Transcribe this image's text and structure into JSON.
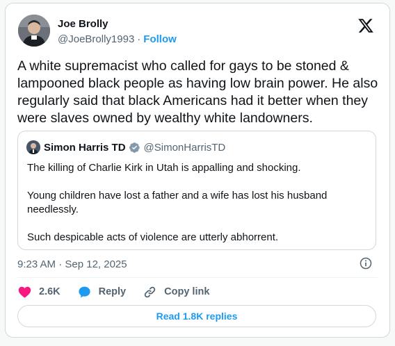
{
  "author": {
    "name": "Joe Brolly",
    "handle": "@JoeBrolly1993",
    "separator": "·",
    "follow_label": "Follow"
  },
  "tweet": {
    "text": "A white supremacist who called for gays to be stoned & lampooned black people as having low brain power. He also regularly said that black Americans had it better when they were slaves owned by wealthy white landowners."
  },
  "quoted": {
    "name": "Simon Harris TD",
    "handle": "@SimonHarrisTD",
    "paragraphs": [
      "The killing of Charlie Kirk in Utah is appalling and shocking.",
      "Young children have lost a father and a wife has lost his husband needlessly.",
      "Such despicable acts of violence are utterly abhorrent."
    ],
    "verified_badge_icon": "verified-gray-badge-icon"
  },
  "timestamp": "9:23 AM · Sep 12, 2025",
  "actions": {
    "like_count": "2.6K",
    "reply_label": "Reply",
    "copy_link_label": "Copy link"
  },
  "read_replies_label": "Read 1.8K replies",
  "colors": {
    "accent": "#1d9bf0",
    "like": "#f91880",
    "muted_text": "#536471",
    "border": "#cfd9de"
  }
}
